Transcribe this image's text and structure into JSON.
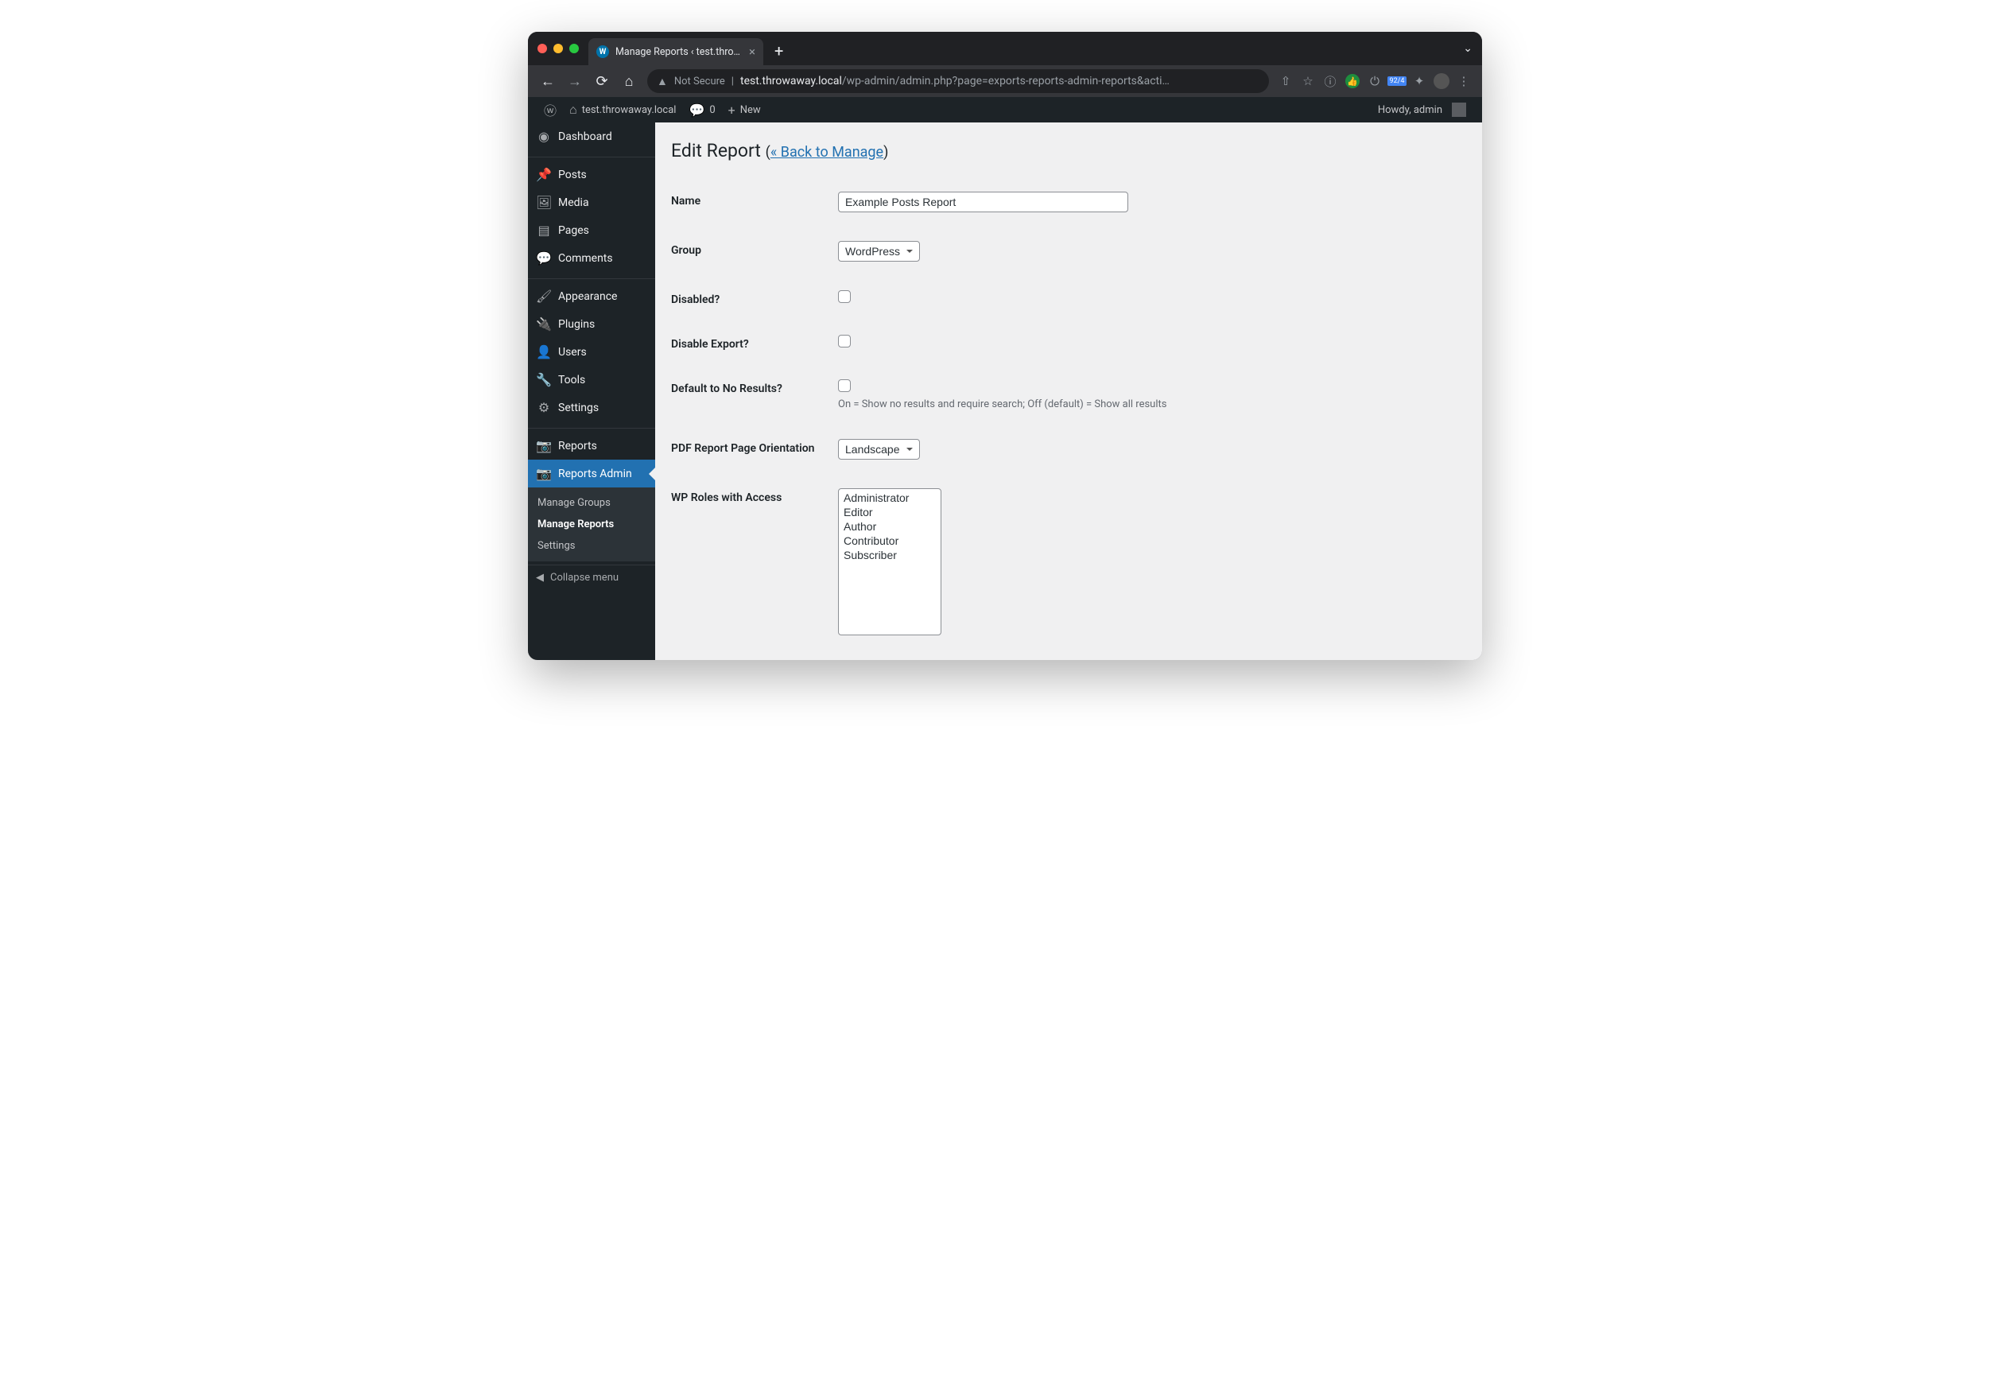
{
  "browser": {
    "tab_title": "Manage Reports ‹ test.throwa",
    "url_prefix": "Not Secure",
    "url_host": "test.throwaway.local",
    "url_path": "/wp-admin/admin.php?page=exports-reports-admin-reports&acti…",
    "badge": "92/4"
  },
  "adminbar": {
    "site": "test.throwaway.local",
    "comments": "0",
    "new": "New",
    "howdy": "Howdy, admin"
  },
  "sidebar": {
    "items": [
      {
        "icon": "⌂",
        "label": "Dashboard"
      },
      {
        "icon": "✎",
        "label": "Posts"
      },
      {
        "icon": "▣",
        "label": "Media"
      },
      {
        "icon": "▤",
        "label": "Pages"
      },
      {
        "icon": "✉",
        "label": "Comments"
      },
      {
        "icon": "✂",
        "label": "Appearance"
      },
      {
        "icon": "⚙",
        "label": "Plugins"
      },
      {
        "icon": "👤",
        "label": "Users"
      },
      {
        "icon": "🔧",
        "label": "Tools"
      },
      {
        "icon": "⚒",
        "label": "Settings"
      },
      {
        "icon": "📷",
        "label": "Reports"
      },
      {
        "icon": "📷",
        "label": "Reports Admin"
      }
    ],
    "submenu": [
      "Manage Groups",
      "Manage Reports",
      "Settings"
    ],
    "collapse": "Collapse menu"
  },
  "page": {
    "title": "Edit Report",
    "back_link": "« Back to Manage",
    "fields": {
      "name": {
        "label": "Name",
        "value": "Example Posts Report"
      },
      "group": {
        "label": "Group",
        "value": "WordPress"
      },
      "disabled": {
        "label": "Disabled?"
      },
      "disable_export": {
        "label": "Disable Export?"
      },
      "no_results": {
        "label": "Default to No Results?",
        "desc": "On = Show no results and require search; Off (default) = Show all results"
      },
      "pdf": {
        "label": "PDF Report Page Orientation",
        "value": "Landscape"
      },
      "roles": {
        "label": "WP Roles with Access",
        "options": [
          "Administrator",
          "Editor",
          "Author",
          "Contributor",
          "Subscriber"
        ]
      }
    }
  }
}
